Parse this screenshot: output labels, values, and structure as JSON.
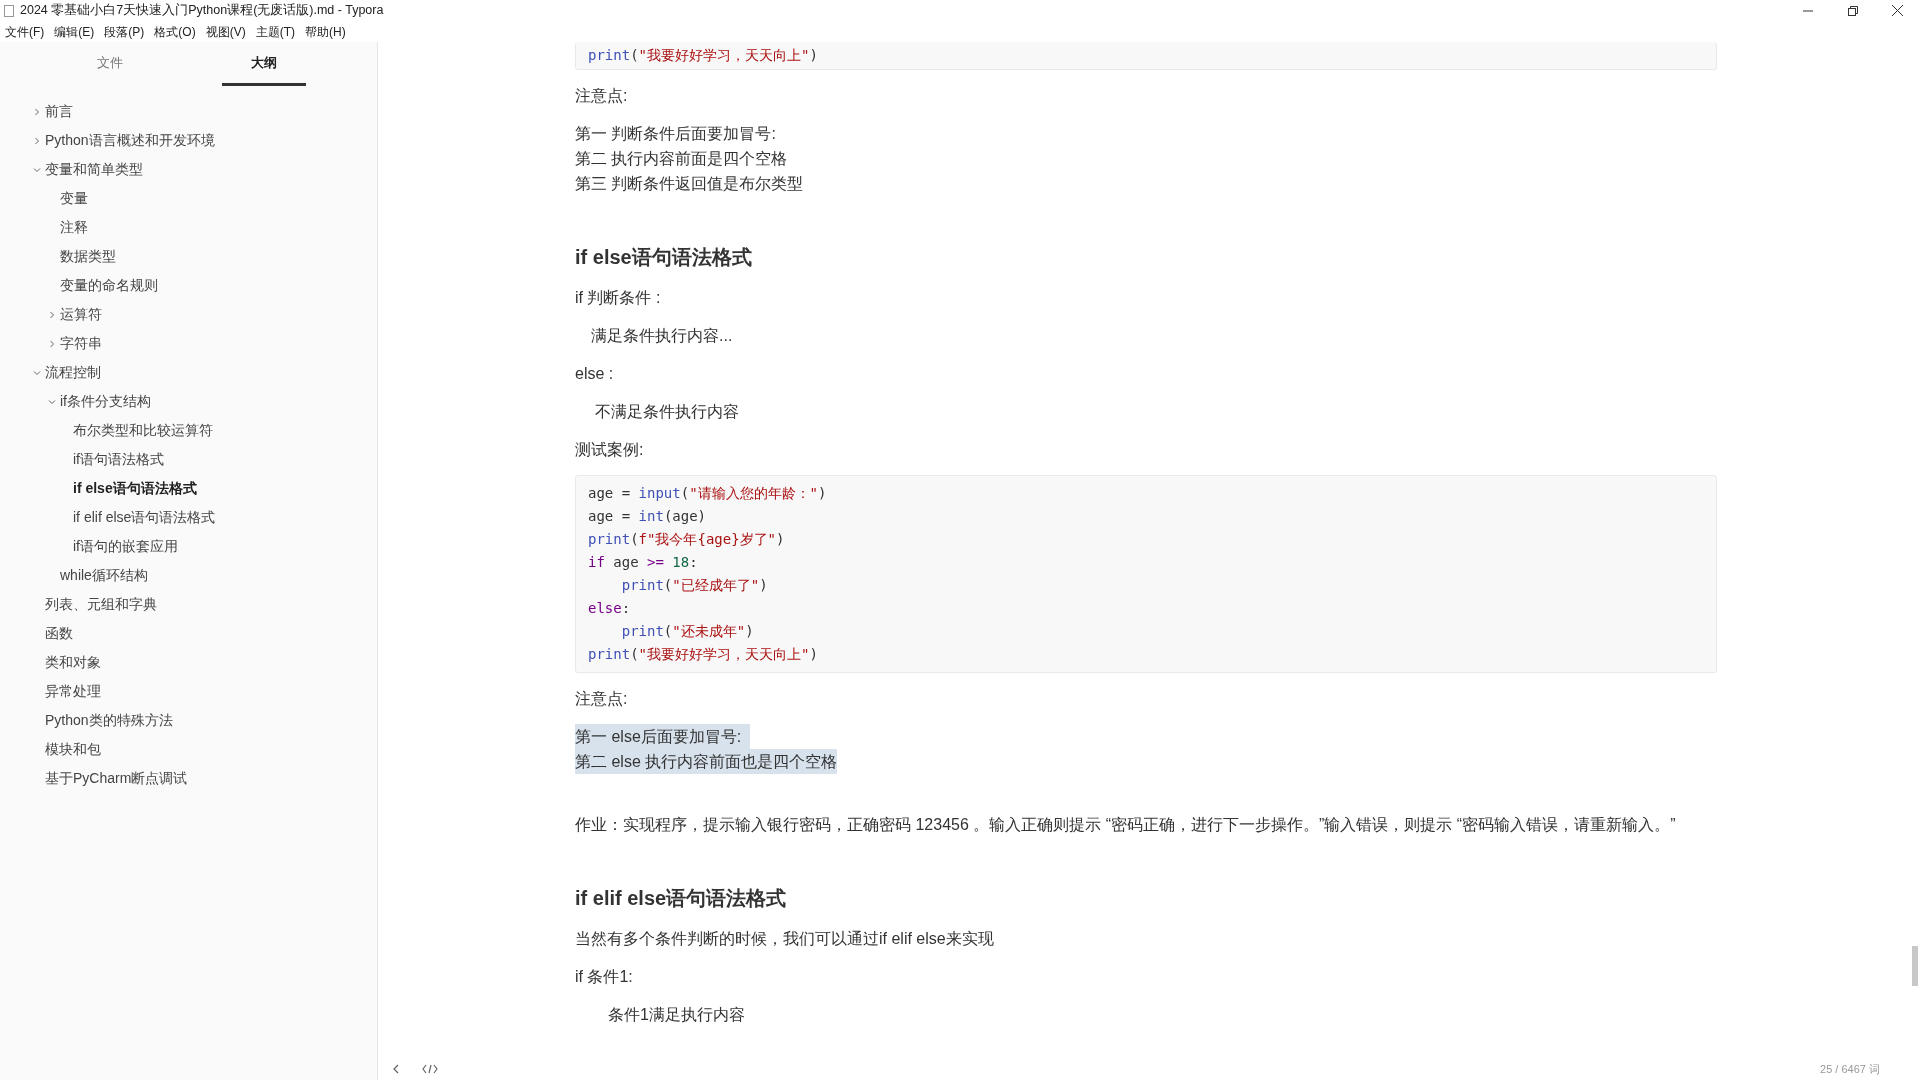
{
  "window": {
    "title": "2024 零基础小白7天快速入门Python课程(无废话版).md - Typora"
  },
  "menu": [
    "文件(F)",
    "编辑(E)",
    "段落(P)",
    "格式(O)",
    "视图(V)",
    "主题(T)",
    "帮助(H)"
  ],
  "sidebar": {
    "tabs": [
      {
        "label": "文件",
        "selected": false
      },
      {
        "label": "大纲",
        "selected": true
      }
    ],
    "outline": [
      {
        "label": "前言",
        "expanded": false,
        "selected": false
      },
      {
        "label": "Python语言概述和开发环境",
        "expanded": false,
        "selected": false
      },
      {
        "label": "变量和简单类型",
        "expanded": true,
        "selected": false,
        "children": [
          {
            "label": "变量",
            "selected": false
          },
          {
            "label": "注释",
            "selected": false
          },
          {
            "label": "数据类型",
            "selected": false
          },
          {
            "label": "变量的命名规则",
            "selected": false
          },
          {
            "label": "运算符",
            "expanded": false,
            "selected": false
          },
          {
            "label": "字符串",
            "expanded": false,
            "selected": false
          }
        ]
      },
      {
        "label": "流程控制",
        "expanded": true,
        "selected": false,
        "children": [
          {
            "label": "if条件分支结构",
            "expanded": true,
            "selected": false,
            "children": [
              {
                "label": "布尔类型和比较运算符",
                "selected": false
              },
              {
                "label": "if语句语法格式",
                "selected": false
              },
              {
                "label": "if else语句语法格式",
                "selected": true
              },
              {
                "label": "if elif else语句语法格式",
                "selected": false
              },
              {
                "label": "if语句的嵌套应用",
                "selected": false
              }
            ]
          },
          {
            "label": "while循环结构",
            "selected": false
          }
        ]
      },
      {
        "label": "列表、元组和字典",
        "selected": false
      },
      {
        "label": "函数",
        "selected": false
      },
      {
        "label": "类和对象",
        "selected": false
      },
      {
        "label": "异常处理",
        "selected": false
      },
      {
        "label": "Python类的特殊方法",
        "selected": false
      },
      {
        "label": "模块和包",
        "selected": false
      },
      {
        "label": "基于PyCharm断点调试",
        "selected": false
      }
    ]
  },
  "document": [
    {
      "kind": "code",
      "lines": [
        [
          {
            "kind": "builtin",
            "t": "print"
          },
          {
            "kind": "plain",
            "t": "("
          },
          {
            "kind": "string",
            "t": "\"我要好好学习，天天向上\""
          },
          {
            "kind": "plain",
            "t": ")"
          }
        ]
      ]
    },
    {
      "kind": "para",
      "text": "注意点:"
    },
    {
      "kind": "lines",
      "selected": false,
      "lines": [
        "第一 判断条件后面要加冒号:",
        "第二 执行内容前面是四个空格",
        "第三 判断条件返回值是布尔类型"
      ]
    },
    {
      "kind": "heading",
      "text": "if else语句语法格式"
    },
    {
      "kind": "para",
      "text": "if 判断条件 :"
    },
    {
      "kind": "indent",
      "text": "满足条件执行内容..."
    },
    {
      "kind": "para",
      "text": "else :"
    },
    {
      "kind": "indent",
      "text": " 不满足条件执行内容"
    },
    {
      "kind": "para",
      "text": "测试案例:"
    },
    {
      "kind": "code",
      "lines": [
        [
          {
            "kind": "plain",
            "t": "age = "
          },
          {
            "kind": "builtin",
            "t": "input"
          },
          {
            "kind": "plain",
            "t": "("
          },
          {
            "kind": "string",
            "t": "\"请输入您的年龄：\""
          },
          {
            "kind": "plain",
            "t": ")"
          }
        ],
        [
          {
            "kind": "plain",
            "t": "age = "
          },
          {
            "kind": "builtin",
            "t": "int"
          },
          {
            "kind": "plain",
            "t": "(age)"
          }
        ],
        [
          {
            "kind": "builtin",
            "t": "print"
          },
          {
            "kind": "plain",
            "t": "("
          },
          {
            "kind": "string",
            "t": "f\"我今年{age}岁了\""
          },
          {
            "kind": "plain",
            "t": ")"
          }
        ],
        [
          {
            "kind": "keyword",
            "t": "if"
          },
          {
            "kind": "plain",
            "t": " age "
          },
          {
            "kind": "keyword",
            "t": ">= "
          },
          {
            "kind": "number",
            "t": "18"
          },
          {
            "kind": "plain",
            "t": ":"
          }
        ],
        [
          {
            "kind": "builtin",
            "t": "    print"
          },
          {
            "kind": "plain",
            "t": "("
          },
          {
            "kind": "string",
            "t": "\"已经成年了\""
          },
          {
            "kind": "plain",
            "t": ")"
          }
        ],
        [
          {
            "kind": "keyword",
            "t": "else"
          },
          {
            "kind": "plain",
            "t": ":"
          }
        ],
        [
          {
            "kind": "builtin",
            "t": "    print"
          },
          {
            "kind": "plain",
            "t": "("
          },
          {
            "kind": "string",
            "t": "\"还未成年\""
          },
          {
            "kind": "plain",
            "t": ")"
          }
        ],
        [
          {
            "kind": "builtin",
            "t": "print"
          },
          {
            "kind": "plain",
            "t": "("
          },
          {
            "kind": "string",
            "t": "\"我要好好学习，天天向上\""
          },
          {
            "kind": "plain",
            "t": ")"
          }
        ]
      ]
    },
    {
      "kind": "para",
      "text": "注意点:"
    },
    {
      "kind": "lines",
      "selected": true,
      "lines": [
        "第一 else后面要加冒号:  ",
        "第二 else 执行内容前面也是四个空格"
      ]
    },
    {
      "kind": "gap"
    },
    {
      "kind": "para",
      "text": "作业：实现程序，提示输入银行密码，正确密码 123456 。输入正确则提示 “密码正确，进行下一步操作。”输入错误，则提示 “密码输入错误，请重新输入。”"
    },
    {
      "kind": "heading",
      "text": "if elif else语句语法格式"
    },
    {
      "kind": "para",
      "text": "当然有多个条件判断的时候，我们可以通过if elif else来实现"
    },
    {
      "kind": "para",
      "text": "if 条件1:"
    },
    {
      "kind": "indent2",
      "text": "条件1满足执行内容"
    }
  ],
  "status_bar": {
    "word_count": "25 / 6467 词"
  }
}
